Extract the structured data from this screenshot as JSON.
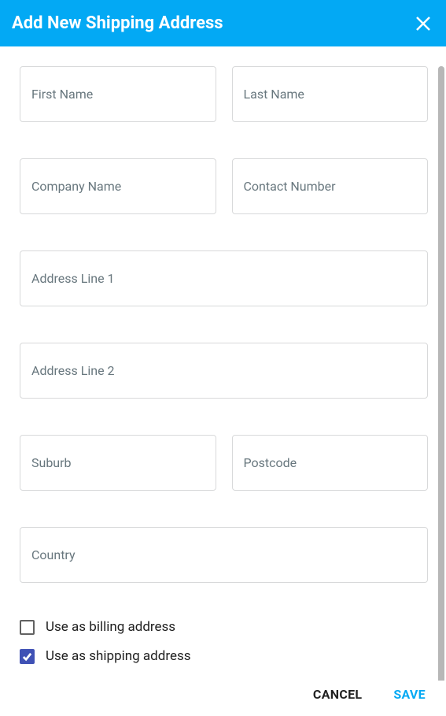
{
  "header": {
    "title": "Add New Shipping Address"
  },
  "fields": {
    "first_name": {
      "placeholder": "First Name",
      "value": ""
    },
    "last_name": {
      "placeholder": "Last Name",
      "value": ""
    },
    "company_name": {
      "placeholder": "Company Name",
      "value": ""
    },
    "contact_number": {
      "placeholder": "Contact Number",
      "value": ""
    },
    "address_line_1": {
      "placeholder": "Address Line 1",
      "value": ""
    },
    "address_line_2": {
      "placeholder": "Address Line 2",
      "value": ""
    },
    "suburb": {
      "placeholder": "Suburb",
      "value": ""
    },
    "postcode": {
      "placeholder": "Postcode",
      "value": ""
    },
    "country": {
      "placeholder": "Country",
      "value": ""
    }
  },
  "checkboxes": {
    "billing": {
      "label": "Use as billing address",
      "checked": false
    },
    "shipping": {
      "label": "Use as shipping address",
      "checked": true
    }
  },
  "actions": {
    "cancel": "Cancel",
    "save": "Save"
  }
}
